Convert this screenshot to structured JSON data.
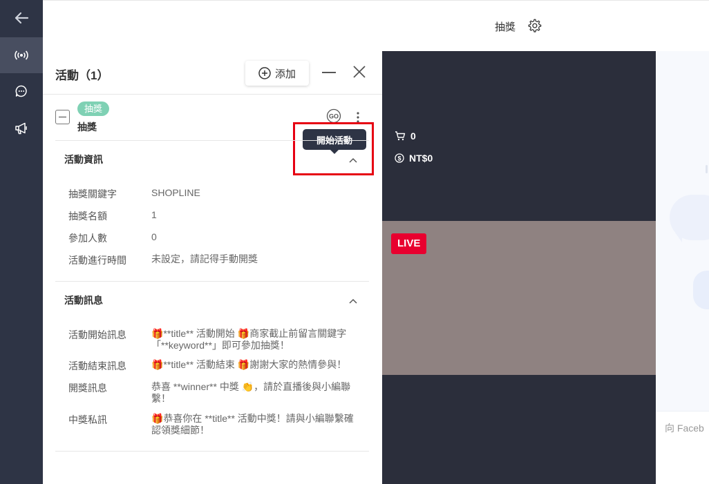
{
  "header": {
    "title": "抽獎",
    "settings_icon": "gear-icon"
  },
  "rail": {
    "icons": [
      "arrow-left-icon",
      "live-broadcast-icon",
      "chat-bubble-icon",
      "megaphone-icon"
    ],
    "accent": "#2e3445"
  },
  "panel": {
    "title": "活動（1）",
    "add_label": "添加",
    "tooltip": "開始活動",
    "item": {
      "tag": "抽獎",
      "name": "抽獎"
    },
    "info_section": {
      "title": "活動資訊",
      "rows": [
        {
          "key": "抽獎關鍵字",
          "value": "SHOPLINE"
        },
        {
          "key": "抽獎名額",
          "value": "1"
        },
        {
          "key": "參加人數",
          "value": "0"
        },
        {
          "key": "活動進行時間",
          "value": "未設定，請記得手動開獎"
        }
      ]
    },
    "message_section": {
      "title": "活動訊息",
      "rows": [
        {
          "key": "活動開始訊息",
          "value": "🎁**title** 活動開始 🎁商家截止前留言關鍵字「**keyword**」即可參加抽獎！"
        },
        {
          "key": "活動結束訊息",
          "value": "🎁**title** 活動結束 🎁謝謝大家的熱情參與！"
        },
        {
          "key": "開獎訊息",
          "value": "恭喜 **winner** 中獎 👏，請於直播後與小編聯繫！"
        },
        {
          "key": "中獎私訊",
          "value": "🎁恭喜你在 **title** 活動中獎！請與小編聯繫確認領獎細節！"
        }
      ]
    }
  },
  "stats": {
    "cart_count": "0",
    "revenue": "NT$0"
  },
  "video": {
    "live_label": "LIVE",
    "live_color": "#e8002f"
  },
  "chat": {
    "placeholder": "向 Faceb"
  },
  "colors": {
    "tag": "#7fd1b4",
    "highlight": "#e60012",
    "dark": "#2b2e3b"
  }
}
